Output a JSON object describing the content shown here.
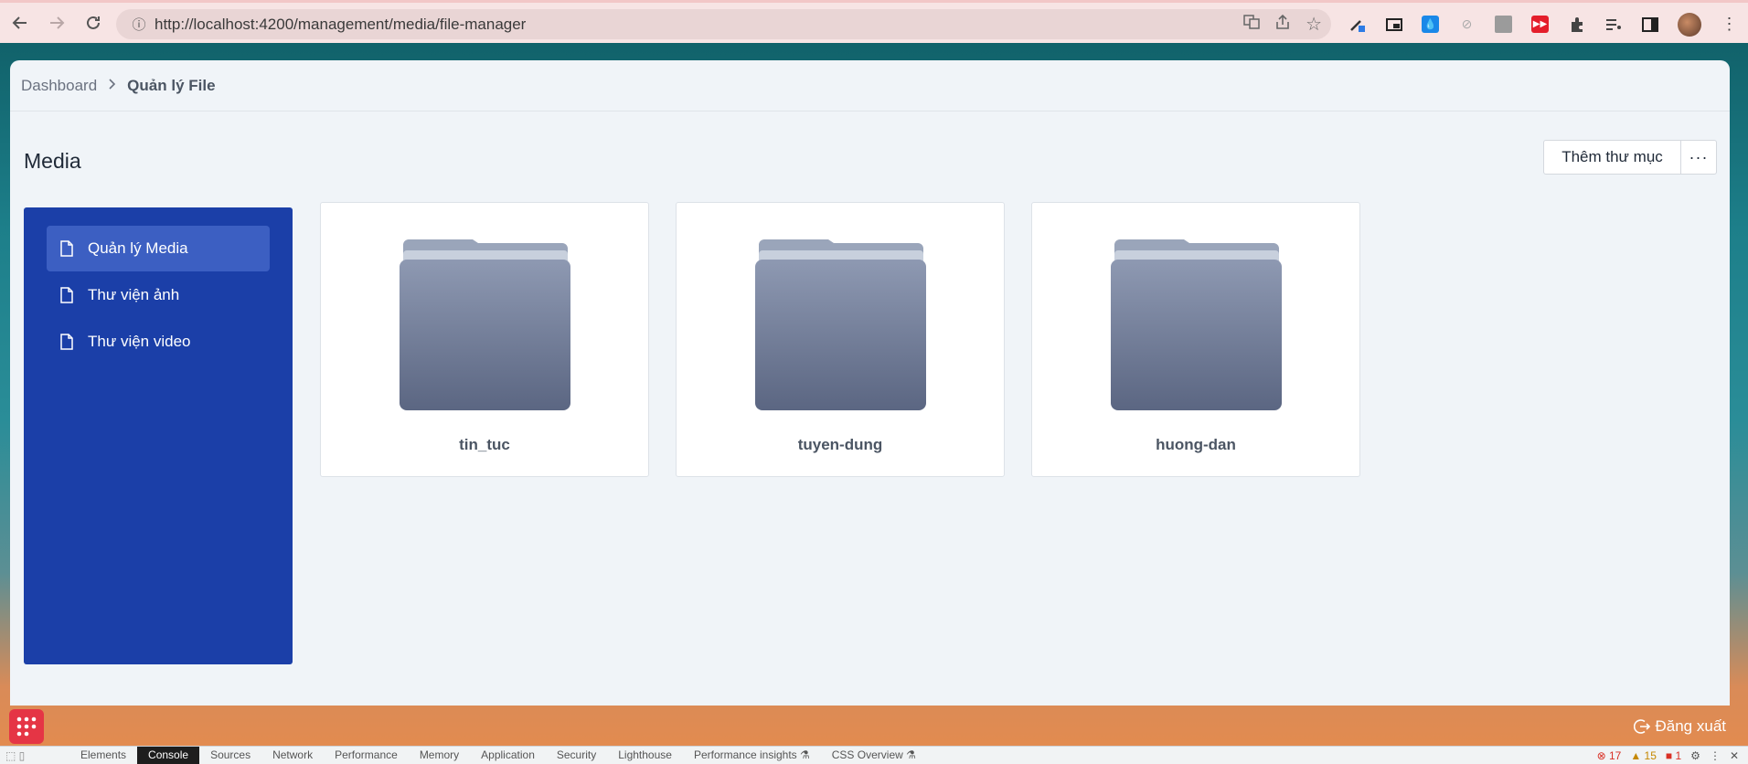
{
  "browser": {
    "url": "http://localhost:4200/management/media/file-manager"
  },
  "breadcrumb": {
    "home": "Dashboard",
    "current": "Quản lý File"
  },
  "page": {
    "title": "Media",
    "add_folder_label": "Thêm thư mục",
    "more_label": "···"
  },
  "sidebar": {
    "items": [
      {
        "label": "Quản lý Media",
        "active": true
      },
      {
        "label": "Thư viện ảnh",
        "active": false
      },
      {
        "label": "Thư viện video",
        "active": false
      }
    ]
  },
  "folders": [
    {
      "name": "tin_tuc"
    },
    {
      "name": "tuyen-dung"
    },
    {
      "name": "huong-dan"
    }
  ],
  "footer": {
    "logout_label": "Đăng xuất"
  },
  "devtools": {
    "tabs": [
      "Elements",
      "Console",
      "Sources",
      "Network",
      "Performance",
      "Memory",
      "Application",
      "Security",
      "Lighthouse",
      "Performance insights ⚗",
      "CSS Overview ⚗"
    ],
    "active_tab": "Console",
    "errors": "17",
    "warnings": "15",
    "issues": "1"
  },
  "colors": {
    "sidebar": "#1b3fa8",
    "sidebar_active": "#3c5fc2",
    "fab": "#e53545"
  }
}
